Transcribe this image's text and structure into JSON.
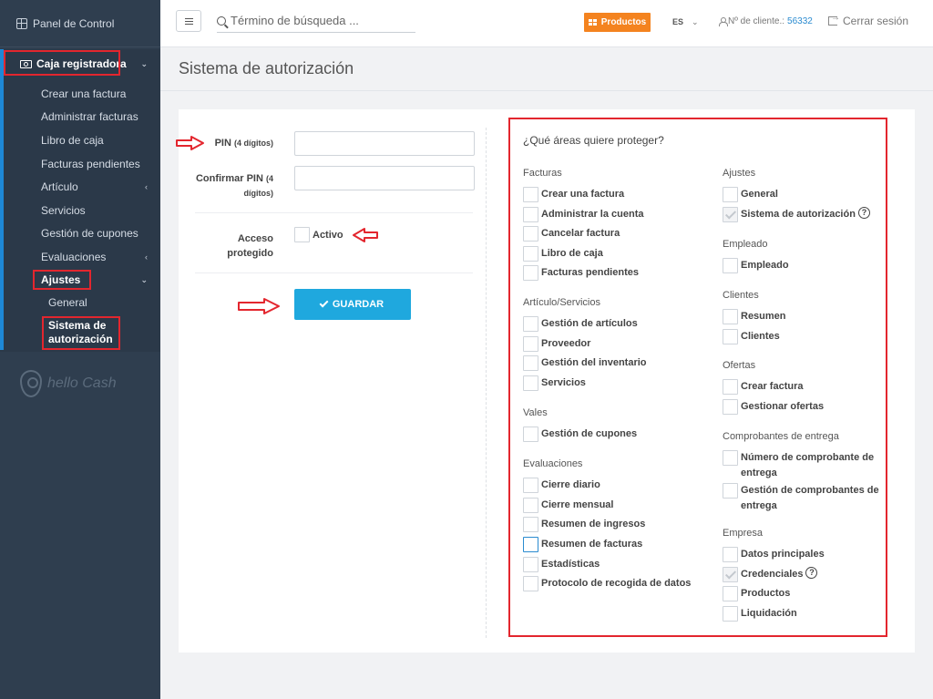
{
  "sidebar": {
    "dashboard": "Panel de Control",
    "group": "Caja registradora",
    "items": [
      "Crear una factura",
      "Administrar facturas",
      "Libro de caja",
      "Facturas pendientes",
      "Artículo",
      "Servicios",
      "Gestión de cupones",
      "Evaluaciones"
    ],
    "ajustes": "Ajustes",
    "sub_general": "General",
    "sub_active": "Sistema de autorización",
    "logo_text": "hello Cash"
  },
  "topbar": {
    "search_placeholder": "Término de búsqueda ...",
    "products_label": "Productos",
    "lang": "ES",
    "customer_label": "Nº de cliente.:",
    "customer_number": "56332",
    "logout": "Cerrar sesión"
  },
  "page": {
    "title": "Sistema de autorización"
  },
  "form": {
    "pin_label": "PIN",
    "pin_hint": "(4 dígitos)",
    "confirm_label": "Confirmar PIN",
    "confirm_hint": "(4 dígitos)",
    "access_label_1": "Acceso",
    "access_label_2": "protegido",
    "active_label": "Activo",
    "save_label": "GUARDAR"
  },
  "areas": {
    "title": "¿Qué áreas quiere proteger?",
    "left": [
      {
        "title": "Facturas",
        "items": [
          "Crear una factura",
          "Administrar la cuenta",
          "Cancelar factura",
          "Libro de caja",
          "Facturas pendientes"
        ]
      },
      {
        "title": "Artículo/Servicios",
        "items": [
          "Gestión de artículos",
          "Proveedor",
          "Gestión del inventario",
          "Servicios"
        ]
      },
      {
        "title": "Vales",
        "items": [
          "Gestión de cupones"
        ]
      },
      {
        "title": "Evaluaciones",
        "items": [
          "Cierre diario",
          "Cierre mensual",
          "Resumen de ingresos",
          "Resumen de facturas",
          "Estadísticas",
          "Protocolo de recogida de datos"
        ]
      }
    ],
    "right": [
      {
        "title": "Ajustes",
        "items": [
          "General",
          "Sistema de autorización"
        ]
      },
      {
        "title": "Empleado",
        "items": [
          "Empleado"
        ]
      },
      {
        "title": "Clientes",
        "items": [
          "Resumen",
          "Clientes"
        ]
      },
      {
        "title": "Ofertas",
        "items": [
          "Crear factura",
          "Gestionar ofertas"
        ]
      },
      {
        "title": "Comprobantes de entrega",
        "items": [
          "Número de comprobante de entrega",
          "Gestión de comprobantes de entrega"
        ]
      },
      {
        "title": "Empresa",
        "items": [
          "Datos principales",
          "Credenciales",
          "Productos",
          "Liquidación"
        ]
      }
    ],
    "help_glyph": "?"
  },
  "colors": {
    "accent": "#1fa8de",
    "highlight": "#e3262e",
    "products": "#f4831f",
    "sidebar": "#2f3e4f"
  }
}
